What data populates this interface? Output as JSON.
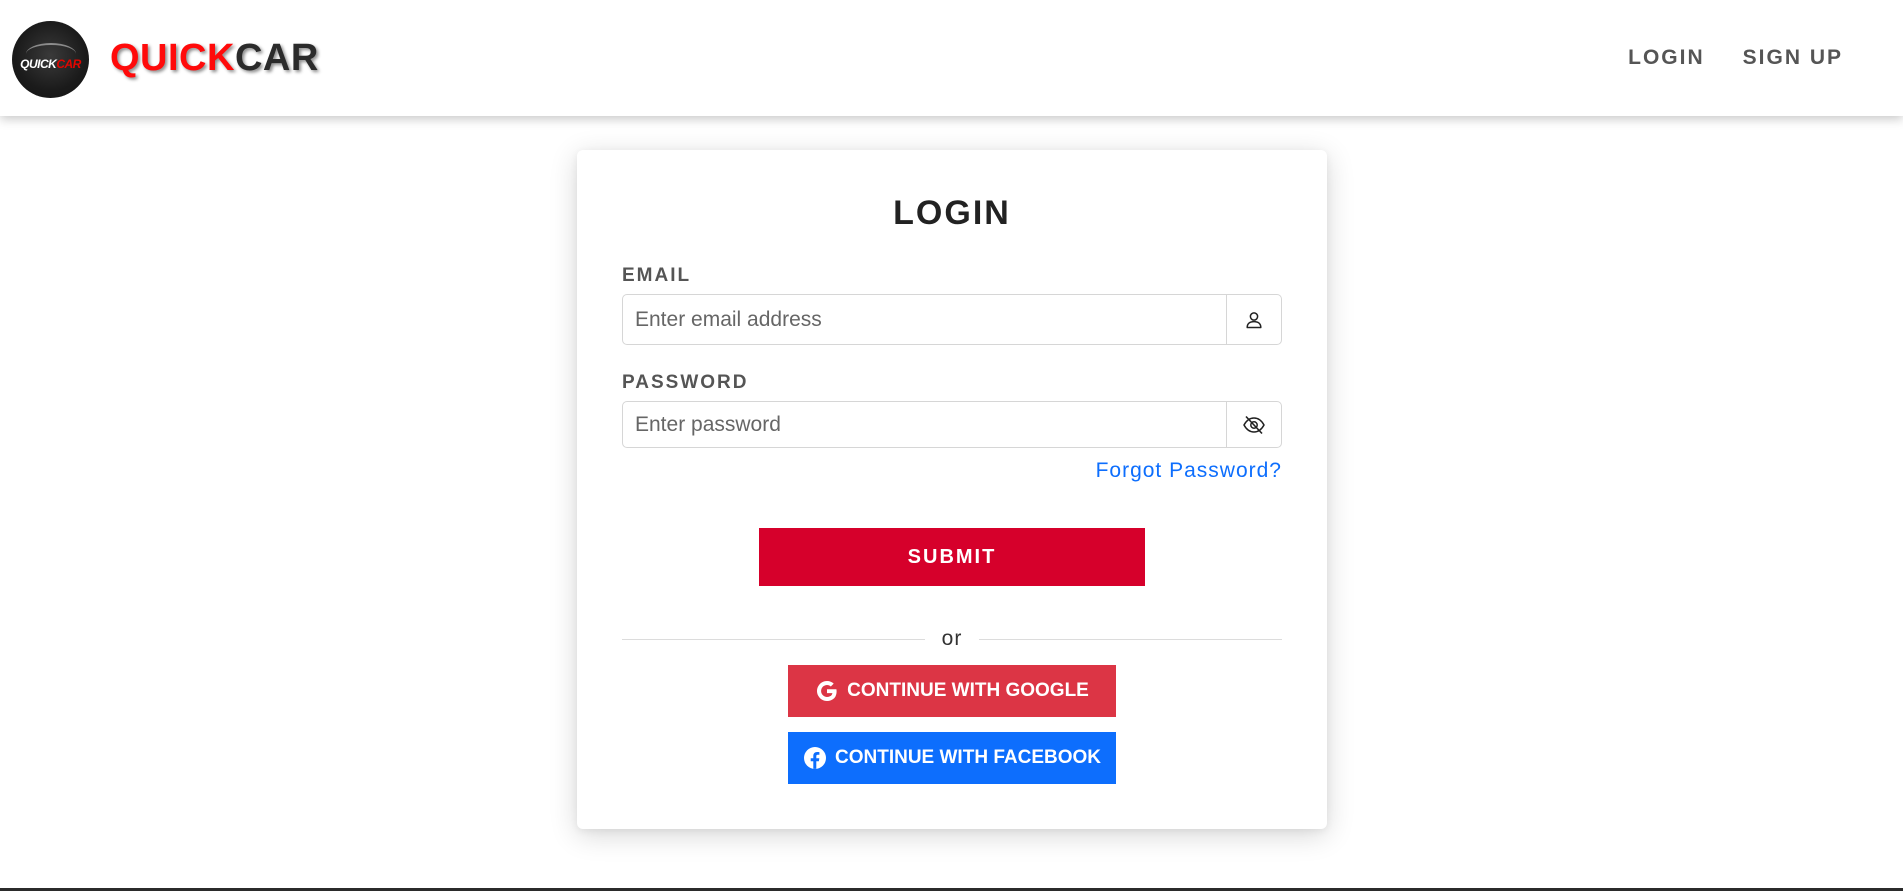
{
  "header": {
    "logo_text_left": "QUICK",
    "logo_text_right": "CAR",
    "brand_part1": "QUICK",
    "brand_part2": "CAR",
    "nav": [
      {
        "label": "LOGIN"
      },
      {
        "label": "SIGN UP"
      }
    ]
  },
  "login_form": {
    "title": "LOGIN",
    "email": {
      "label": "EMAIL",
      "placeholder": "Enter email address",
      "value": "",
      "icon": "user-icon"
    },
    "password": {
      "label": "PASSWORD",
      "placeholder": "Enter password",
      "value": "",
      "icon": "eye-slash-icon"
    },
    "forgot_password": "Forgot Password?",
    "submit_label": "SUBMIT",
    "divider_text": "or",
    "google_label": "CONTINUE WITH GOOGLE",
    "facebook_label": "CONTINUE WITH FACEBOOK"
  },
  "colors": {
    "brand_red": "#ff0a0a",
    "submit_red": "#d6002b",
    "google_red": "#dc3545",
    "facebook_blue": "#0d6efd",
    "link_blue": "#0d6efd",
    "nav_gray": "#555555"
  }
}
